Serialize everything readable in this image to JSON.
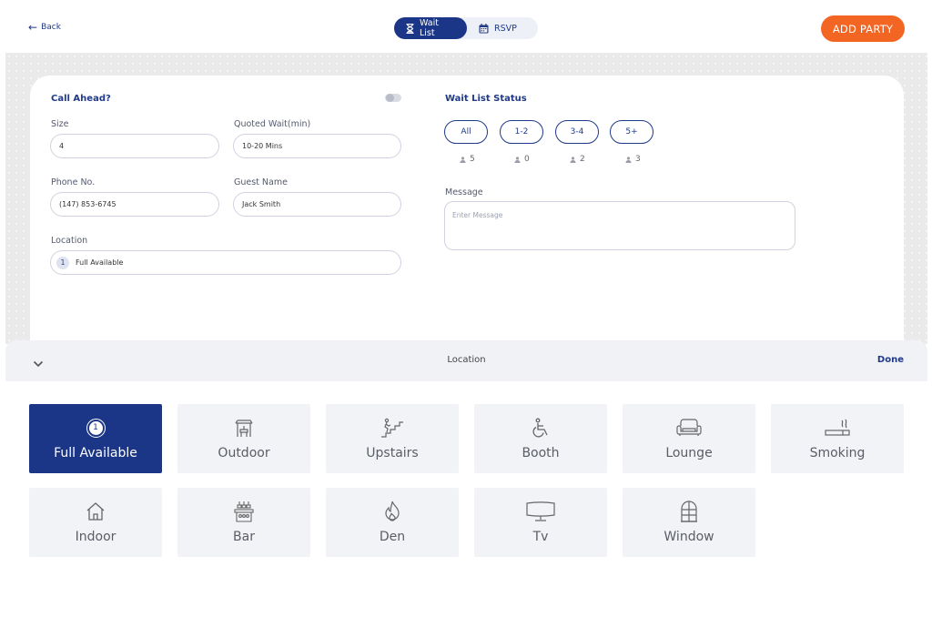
{
  "header": {
    "back_label": "Back",
    "tabs": [
      {
        "label": "Wait List",
        "icon": "hourglass-icon",
        "active": true
      },
      {
        "label": "RSVP",
        "icon": "calendar-icon",
        "active": false
      }
    ],
    "add_party_label": "ADD PARTY",
    "accent": "#f26522",
    "primary": "#1c3687"
  },
  "form": {
    "call_ahead_label": "Call Ahead?",
    "call_ahead_on": false,
    "size": {
      "label": "Size",
      "value": "4"
    },
    "quoted_wait": {
      "label": "Quoted Wait(min)",
      "value": "10-20 Mins"
    },
    "phone": {
      "label": "Phone No.",
      "value": "(147) 853-6745"
    },
    "guest_name": {
      "label": "Guest Name",
      "value": "Jack Smith"
    },
    "location": {
      "label": "Location",
      "badge": "1",
      "value": "Full Available"
    }
  },
  "status": {
    "title": "Wait List Status",
    "filters": [
      {
        "label": "All",
        "count": "5"
      },
      {
        "label": "1-2",
        "count": "0"
      },
      {
        "label": "3-4",
        "count": "2"
      },
      {
        "label": "5+",
        "count": "3"
      }
    ],
    "message_label": "Message",
    "message_placeholder": "Enter Message"
  },
  "sheet": {
    "title": "Location",
    "done_label": "Done",
    "options": [
      {
        "label": "Full Available",
        "icon": "number-one-icon",
        "selected": true,
        "badge": "1"
      },
      {
        "label": "Outdoor",
        "icon": "pergola-icon"
      },
      {
        "label": "Upstairs",
        "icon": "stairs-icon"
      },
      {
        "label": "Booth",
        "icon": "wheelchair-icon"
      },
      {
        "label": "Lounge",
        "icon": "sofa-icon"
      },
      {
        "label": "Smoking",
        "icon": "cigarette-icon"
      },
      {
        "label": "Indoor",
        "icon": "house-icon"
      },
      {
        "label": "Bar",
        "icon": "bar-counter-icon"
      },
      {
        "label": "Den",
        "icon": "fireplace-icon"
      },
      {
        "label": "Tv",
        "icon": "tv-icon"
      },
      {
        "label": "Window",
        "icon": "window-icon"
      }
    ]
  }
}
